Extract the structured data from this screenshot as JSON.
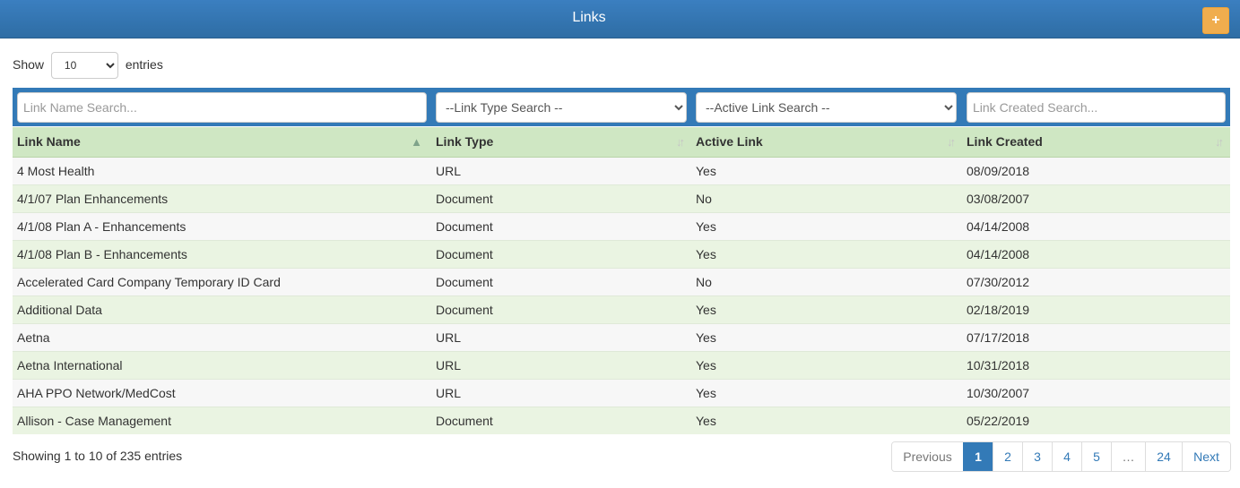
{
  "header": {
    "title": "Links",
    "add_label": "+"
  },
  "length": {
    "prefix": "Show",
    "selected": "10",
    "suffix": "entries"
  },
  "filters": {
    "name_placeholder": "Link Name Search...",
    "type_selected": "--Link Type Search --",
    "active_selected": "--Active Link Search --",
    "created_placeholder": "Link Created Search..."
  },
  "columns": [
    "Link Name",
    "Link Type",
    "Active Link",
    "Link Created"
  ],
  "rows": [
    [
      "4 Most Health",
      "URL",
      "Yes",
      "08/09/2018"
    ],
    [
      "4/1/07 Plan Enhancements",
      "Document",
      "No",
      "03/08/2007"
    ],
    [
      "4/1/08 Plan A - Enhancements",
      "Document",
      "Yes",
      "04/14/2008"
    ],
    [
      "4/1/08 Plan B - Enhancements",
      "Document",
      "Yes",
      "04/14/2008"
    ],
    [
      "Accelerated Card Company Temporary ID Card",
      "Document",
      "No",
      "07/30/2012"
    ],
    [
      "Additional Data",
      "Document",
      "Yes",
      "02/18/2019"
    ],
    [
      "Aetna",
      "URL",
      "Yes",
      "07/17/2018"
    ],
    [
      "Aetna International",
      "URL",
      "Yes",
      "10/31/2018"
    ],
    [
      "AHA PPO Network/MedCost",
      "URL",
      "Yes",
      "10/30/2007"
    ],
    [
      "Allison - Case Management",
      "Document",
      "Yes",
      "05/22/2019"
    ]
  ],
  "info": "Showing 1 to 10 of 235 entries",
  "pagination": {
    "previous": "Previous",
    "pages": [
      "1",
      "2",
      "3",
      "4",
      "5",
      "…",
      "24"
    ],
    "active_page": "1",
    "next": "Next"
  }
}
